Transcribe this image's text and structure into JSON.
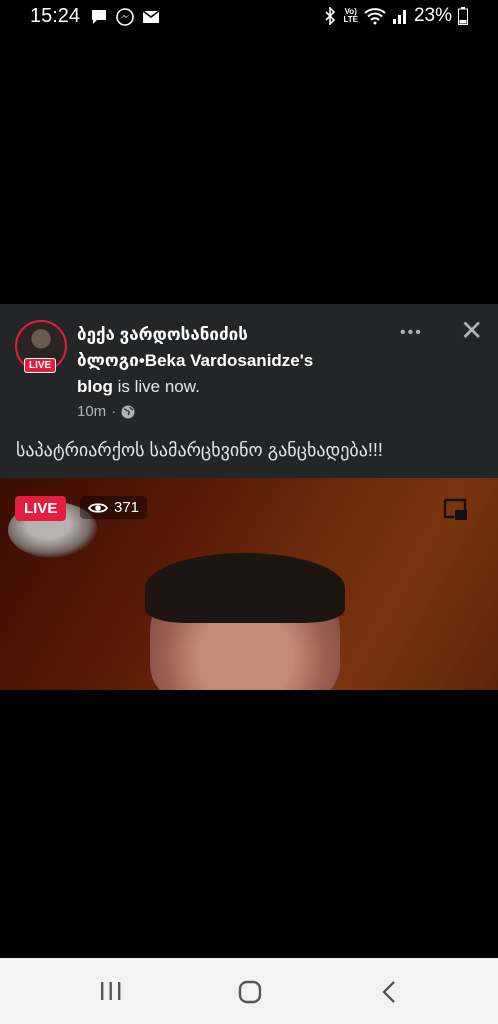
{
  "status_bar": {
    "time": "15:24",
    "battery": "23%",
    "lte_top": "Vo)",
    "lte_bottom": "LTE",
    "icons": [
      "message-icon",
      "messenger-icon",
      "mail-icon",
      "bluetooth-icon",
      "wifi-icon",
      "signal-icon",
      "battery-icon"
    ]
  },
  "post": {
    "page_name_line1": "ბექა ვარდოსანიძის",
    "page_name_line2": "ბლოგი•Beka Vardosanidze's",
    "page_name_line3": "blog",
    "status_suffix": " is live now.",
    "avatar_badge": "LIVE",
    "time_ago": "10m",
    "separator": "·",
    "privacy_icon": "globe-icon",
    "more_label": "•••",
    "close_label": "✕",
    "caption": "საპატრიარქოს სამარცხვინო განცხადება!!!"
  },
  "video": {
    "live_label": "LIVE",
    "viewer_count": "371"
  },
  "nav_bar": {
    "icons": [
      "recent-apps-icon",
      "home-icon",
      "back-icon"
    ]
  },
  "colors": {
    "live_red": "#e41e3f",
    "card_bg": "#242526",
    "nav_bg": "#f3f3f3"
  }
}
